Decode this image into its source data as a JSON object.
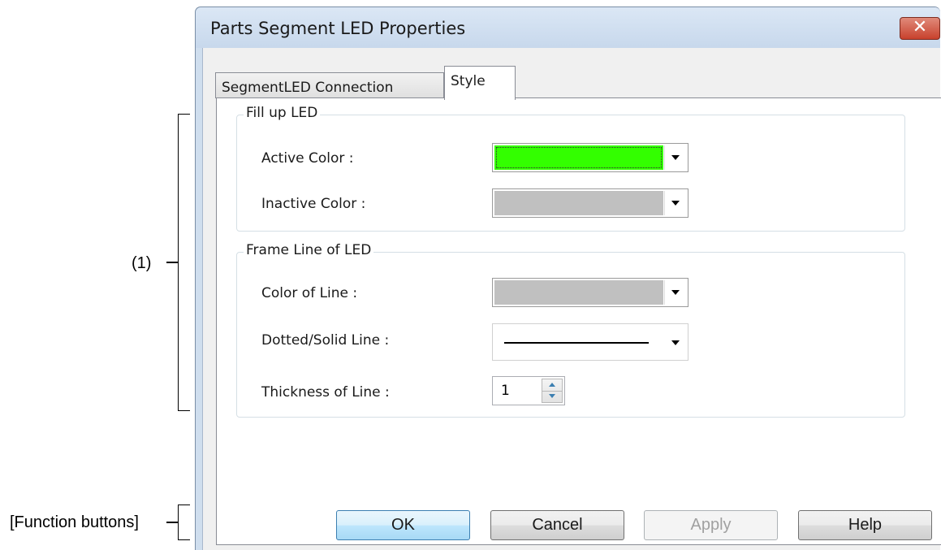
{
  "annotations": {
    "region_1": "(1)",
    "function_buttons": "[Function buttons]"
  },
  "window": {
    "title": "Parts Segment LED Properties",
    "close_glyph": "✕"
  },
  "tabs": [
    {
      "label": "SegmentLED Connection",
      "active": false
    },
    {
      "label": "Style",
      "active": true
    }
  ],
  "fill_group": {
    "title": "Fill up LED",
    "active_color": {
      "label": "Active Color :",
      "value_color": "#33ff00"
    },
    "inactive_color": {
      "label": "Inactive Color :",
      "value_color": "#c0c0c0"
    }
  },
  "frame_group": {
    "title": "Frame Line of LED",
    "color_of_line": {
      "label": "Color of Line :",
      "value_color": "#c0c0c0"
    },
    "dotted_solid": {
      "label": "Dotted/Solid Line :",
      "value": "solid"
    },
    "thickness": {
      "label": "Thickness of Line :",
      "value": "1"
    }
  },
  "buttons": {
    "ok": "OK",
    "cancel": "Cancel",
    "apply": "Apply",
    "help": "Help"
  }
}
